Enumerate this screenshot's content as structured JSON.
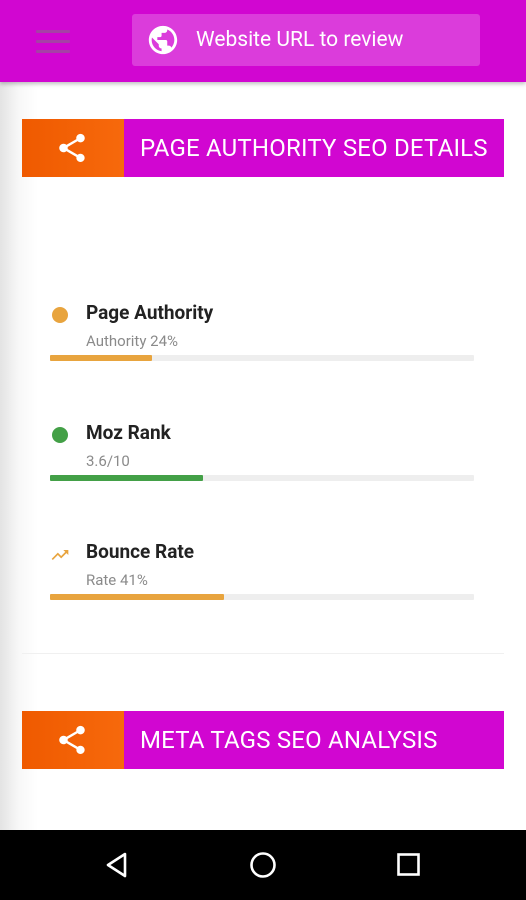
{
  "app_bar": {
    "menu_icon": "hamburger-menu-icon",
    "url_input": {
      "placeholder": "Website URL to review",
      "value": "",
      "icon": "globe-icon"
    }
  },
  "sections": [
    {
      "title": "PAGE AUTHORITY SEO DETAILS",
      "icon": "share-icon"
    },
    {
      "title": "META TAGS SEO ANALYSIS",
      "icon": "share-icon"
    }
  ],
  "metrics": [
    {
      "title": "Page Authority",
      "subtitle": "Authority 24%",
      "icon": "status-dot-icon",
      "color": "#e8a43e",
      "progress": 0.24
    },
    {
      "title": "Moz Rank",
      "subtitle": "3.6/10",
      "icon": "status-dot-icon",
      "color": "#43a047",
      "progress": 0.36
    },
    {
      "title": "Bounce Rate",
      "subtitle": "Rate 41%",
      "icon": "trending-up-icon",
      "color": "#e8a43e",
      "progress": 0.41
    }
  ],
  "colors": {
    "app_bar": "#d106d1",
    "header_title_bg": "#d106d1",
    "header_icon_bg": "#f7690c",
    "track": "#eeeeee",
    "nav_bar": "#000000"
  },
  "nav": {
    "back_icon": "back-triangle-icon",
    "home_icon": "home-circle-icon",
    "recents_icon": "recents-square-icon"
  }
}
